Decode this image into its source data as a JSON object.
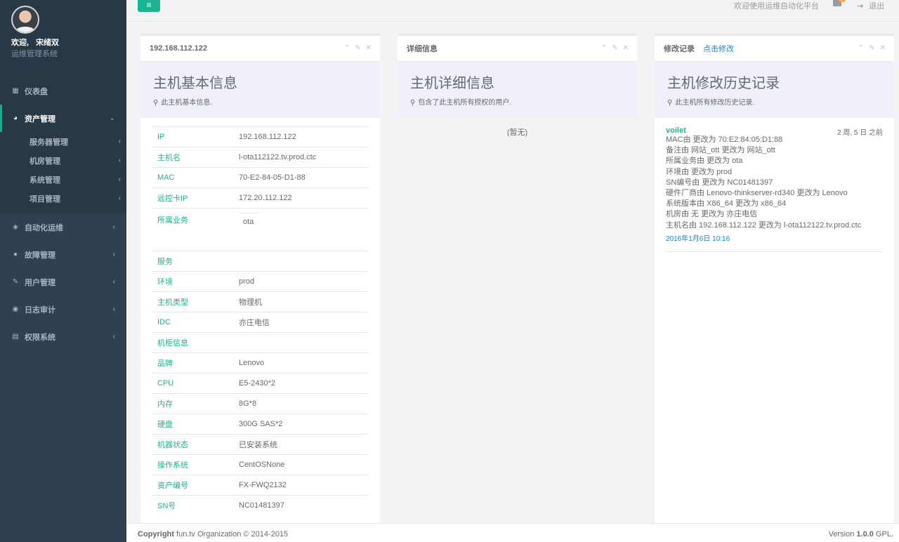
{
  "sidebar": {
    "welcome": "欢迎,",
    "username": "宋绪双",
    "system_name": "运维管理系统",
    "items": [
      {
        "label": "仪表盘",
        "icon": "grid-icon"
      },
      {
        "label": "资产管理",
        "icon": "pie-chart-icon"
      },
      {
        "label": "自动化运维",
        "icon": "cube-icon"
      },
      {
        "label": "故障管理",
        "icon": "bomb-icon"
      },
      {
        "label": "用户管理",
        "icon": "edit-icon"
      },
      {
        "label": "日志审计",
        "icon": "eye-icon"
      },
      {
        "label": "权限系统",
        "icon": "briefcase-icon"
      }
    ],
    "sub_items": [
      "服务器管理",
      "机房管理",
      "系统管理",
      "项目管理"
    ]
  },
  "topbar": {
    "welcome_text": "欢迎使用运维自动化平台",
    "logout_label": "退出"
  },
  "panels": {
    "basic": {
      "header": "192.168.112.122",
      "title": "主机基本信息",
      "subtitle": "此主机基本信息."
    },
    "detail": {
      "header": "详细信息",
      "title": "主机详细信息",
      "subtitle": "包含了此主机所有授权的用户.",
      "empty": "(暂无)"
    },
    "history": {
      "header": "修改记录",
      "header_link": "点击修改",
      "title": "主机修改历史记录",
      "subtitle": "此主机所有修改历史记录."
    }
  },
  "host_info": [
    {
      "key": "IP",
      "value": "192.168.112.122"
    },
    {
      "key": "主机名",
      "value": "l-ota112122.tv.prod.ctc"
    },
    {
      "key": "MAC",
      "value": "70-E2-84-05-D1-88"
    },
    {
      "key": "远控卡IP",
      "value": "172.20.112.122"
    },
    {
      "key": "所属业务",
      "value": "ota"
    },
    {
      "key": "服务",
      "value": ""
    },
    {
      "key": "环境",
      "value": "prod"
    },
    {
      "key": "主机类型",
      "value": "物理机"
    },
    {
      "key": "IDC",
      "value": "亦庄电信"
    },
    {
      "key": "机柜信息",
      "value": ""
    },
    {
      "key": "品牌",
      "value": "Lenovo"
    },
    {
      "key": "CPU",
      "value": "E5-2430*2"
    },
    {
      "key": "内存",
      "value": "8G*8"
    },
    {
      "key": "硬盘",
      "value": "300G SAS*2"
    },
    {
      "key": "机器状态",
      "value": "已安装系统"
    },
    {
      "key": "操作系统",
      "value": "CentOSNone"
    },
    {
      "key": "资产编号",
      "value": "FX-FWQ2132"
    },
    {
      "key": "SN号",
      "value": "NC01481397"
    }
  ],
  "history": {
    "user": "voilet",
    "relative_time": "2 周, 5 日 之前",
    "lines": [
      "MAC由 更改为 70:E2:84:05:D1:88",
      "备注由 网站_ott 更改为 网站_ott",
      "所属业务由 更改为 ota",
      "环境由 更改为 prod",
      "SN编号由 更改为 NC01481397",
      "硬件厂商由 Lenovo-thinkserver-rd340 更改为 Lenovo",
      "系统版本由 X86_64 更改为 x86_64",
      "机房由 无 更改为 亦庄电信",
      "主机名由 192.168.112.122 更改为 l-ota112122.tv.prod.ctc"
    ],
    "date": "2016年1月6日 10:16"
  },
  "footer": {
    "copyright_label": "Copyright",
    "copyright_text": "fun.tv Organization © 2014-2015",
    "version_label": "Version",
    "version_number": "1.0.0",
    "version_suffix": "GPL."
  }
}
